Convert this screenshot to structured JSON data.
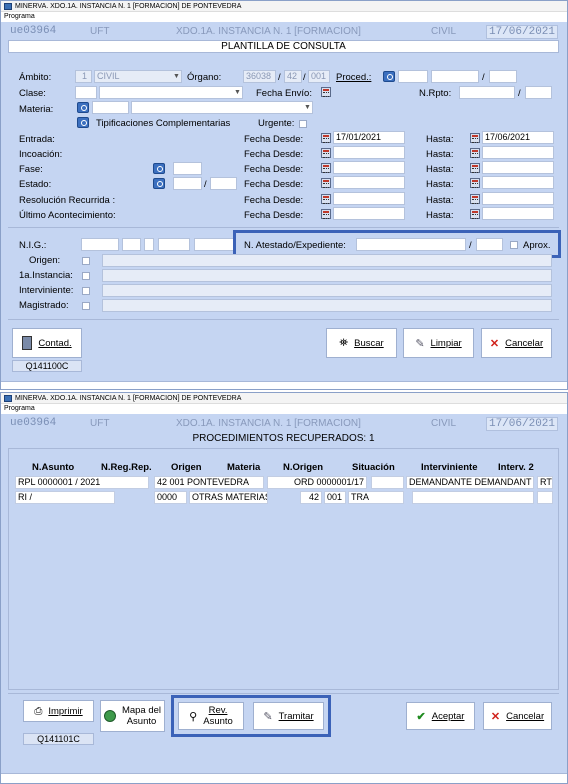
{
  "window1": {
    "title": "MINERVA. XDO.1A. INSTANCIA N. 1 [FORMACION] DE PONTEVEDRA",
    "menu": "Programa",
    "header": {
      "code": "ue03964",
      "uft": "UFT",
      "court": "XDO.1A. INSTANCIA N. 1 [FORMACION]",
      "type": "CIVIL",
      "date": "17/06/2021"
    },
    "subtitle": "PLANTILLA DE CONSULTA",
    "form": {
      "ambito_label": "Ámbito:",
      "ambito_code": "1",
      "ambito_value": "CIVIL",
      "organo_label": "Órgano:",
      "organo_1": "36038",
      "organo_2": "42",
      "organo_3": "001",
      "proced_label": "Proced.:",
      "clase_label": "Clase:",
      "fecha_envio_label": "Fecha Envío:",
      "nrpto_label": "N.Rpto:",
      "materia_label": "Materia:",
      "tipificaciones_label": "Tipificaciones Complementarias",
      "urgente_label": "Urgente:",
      "entrada_label": "Entrada:",
      "incoacion_label": "Incoación:",
      "fase_label": "Fase:",
      "estado_label": "Estado:",
      "resolucion_label": "Resolución Recurrida :",
      "ultimo_label": "Último Acontecimiento:",
      "fecha_desde_label": "Fecha Desde:",
      "hasta_label": "Hasta:",
      "entrada_desde": "17/01/2021",
      "entrada_hasta": "17/06/2021",
      "nig_label": "N.I.G.:",
      "atestado_label": "N. Atestado/Expediente:",
      "aprox_label": "Aprox.",
      "origen_label": "Origen:",
      "instancia_label": "1a.Instancia:",
      "interviniente_label": "Interviniente:",
      "magistrado_label": "Magistrado:"
    },
    "buttons": {
      "contad": "Contad.",
      "buscar": "Buscar",
      "limpiar": "Limpiar",
      "cancelar": "Cancelar"
    },
    "status_code": "Q141100C"
  },
  "window2": {
    "title": "MINERVA. XDO.1A. INSTANCIA N. 1 [FORMACION] DE PONTEVEDRA",
    "menu": "Programa",
    "header": {
      "code": "ue03964",
      "uft": "UFT",
      "court": "XDO.1A. INSTANCIA N. 1 [FORMACION]",
      "type": "CIVIL",
      "date": "17/06/2021"
    },
    "subtitle": "PROCEDIMIENTOS RECUPERADOS: 1",
    "columns": [
      "N.Asunto",
      "N.Reg.Rep.",
      "Origen",
      "Materia",
      "N.Origen",
      "Situación",
      "Interviniente",
      "Interv. 2"
    ],
    "row1": {
      "asunto": "RPL  0000001 / 2021",
      "origen": "42 001 PONTEVEDRA",
      "norigen": "ORD 0000001/17",
      "interviniente": "DEMANDANTE DEMANDANT",
      "interv2": "RT"
    },
    "row2": {
      "asunto": "RI   /",
      "materia_code": "0000",
      "materia": "OTRAS MATERIAS",
      "n1": "42",
      "n2": "001",
      "tra": "TRA"
    },
    "buttons": {
      "imprimir": "Imprimir",
      "mapa1": "Mapa del",
      "mapa2": "Asunto",
      "rev1": "Rev.",
      "rev2": "Asunto",
      "tramitar": "Tramitar",
      "aceptar": "Aceptar",
      "cancelar": "Cancelar"
    },
    "status_code": "Q141101C"
  },
  "colors": {
    "background": "#c5d5f2",
    "highlight": "#3b62b8"
  }
}
